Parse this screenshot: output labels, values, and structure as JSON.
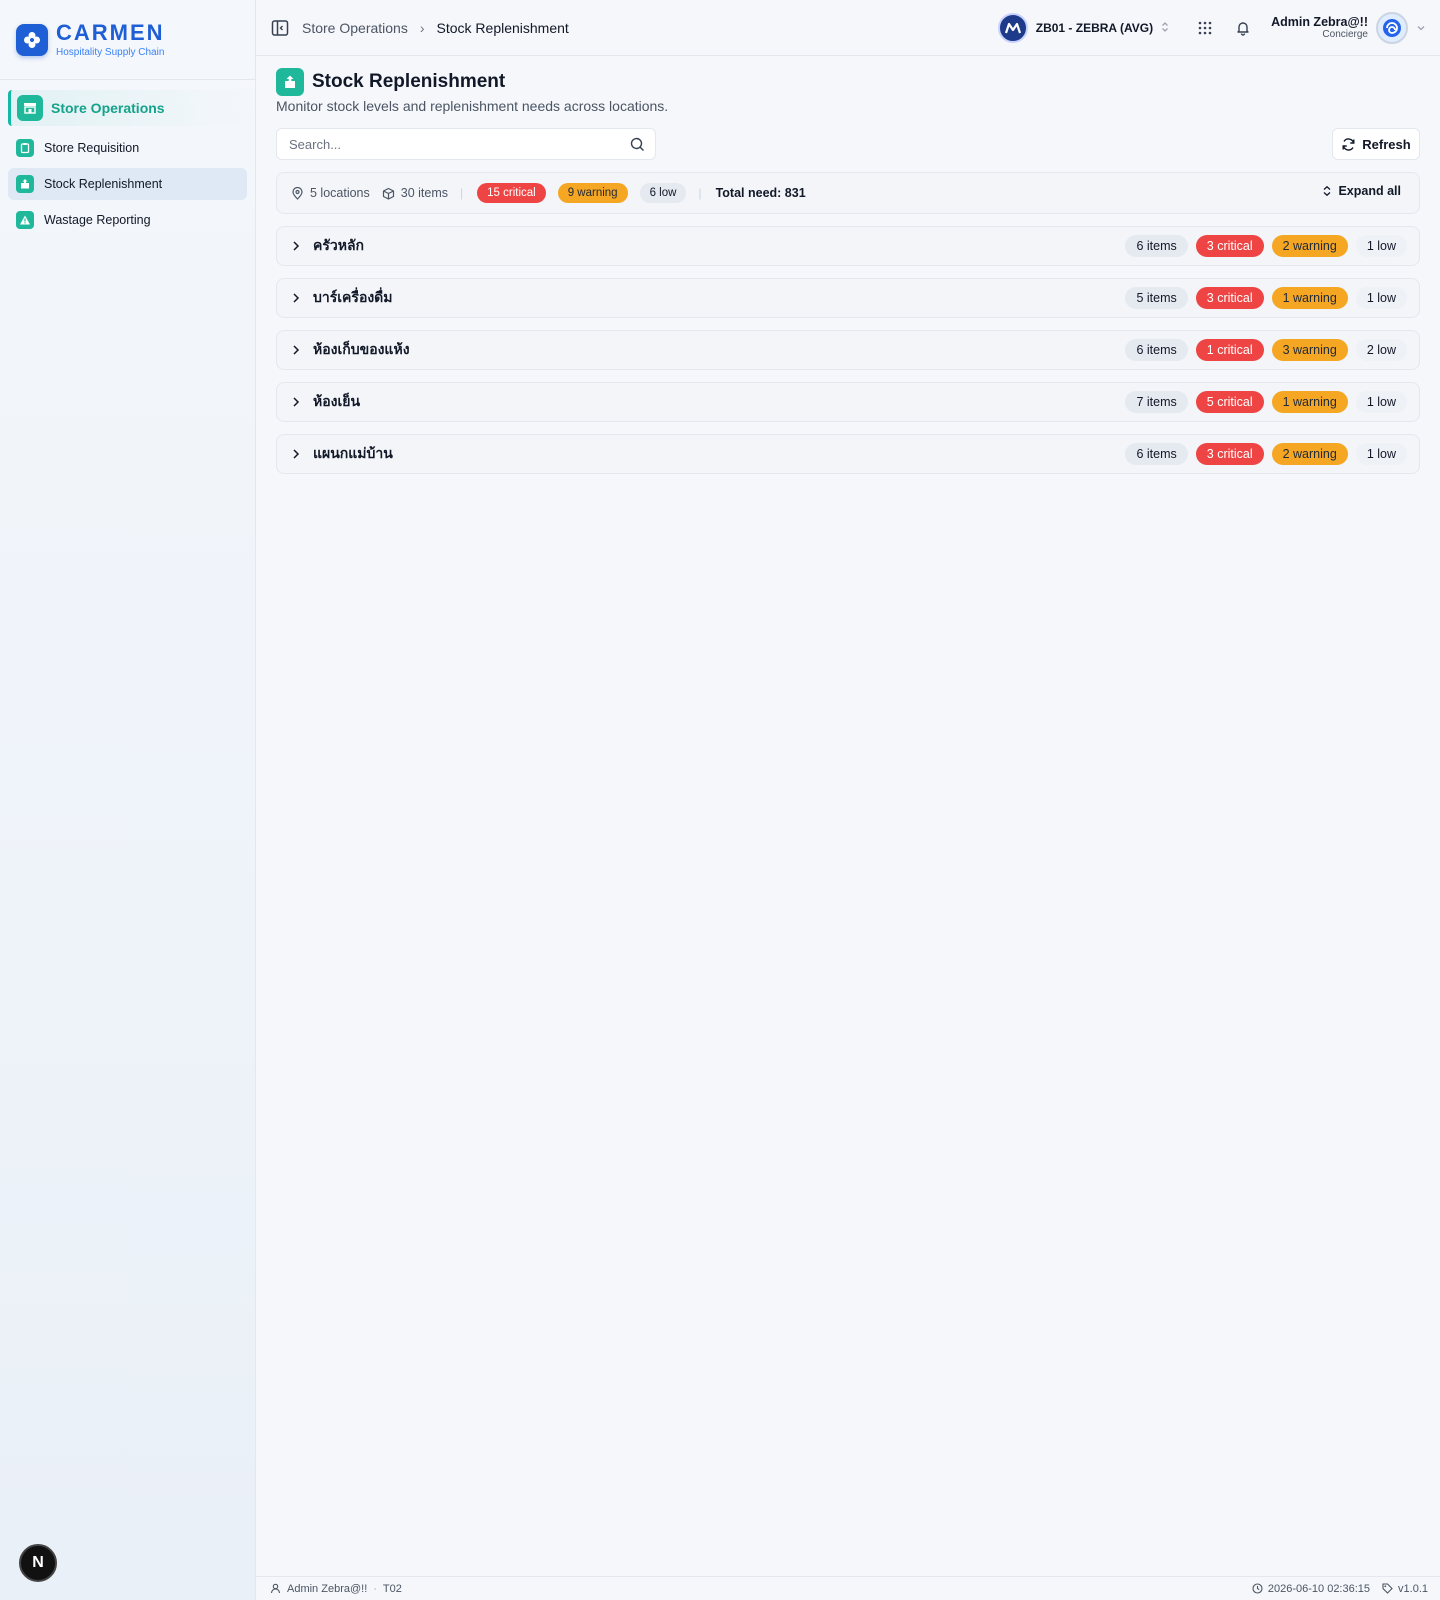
{
  "brand": {
    "name": "CARMEN",
    "tagline": "Hospitality Supply Chain"
  },
  "sidebar": {
    "section_label": "Store Operations",
    "items": [
      {
        "label": "Store Requisition",
        "icon": "clipboard-icon",
        "active": false
      },
      {
        "label": "Stock Replenishment",
        "icon": "package-up-icon",
        "active": true
      },
      {
        "label": "Wastage Reporting",
        "icon": "warning-triangle-icon",
        "active": false
      }
    ],
    "dev_badge": "N"
  },
  "header": {
    "breadcrumb": [
      "Store Operations",
      "Stock Replenishment"
    ],
    "business_unit": "ZB01 - ZEBRA (AVG)",
    "user_name": "Admin Zebra@!!",
    "user_role": "Concierge"
  },
  "page": {
    "title": "Stock Replenishment",
    "subtitle": "Monitor stock levels and replenishment needs across locations.",
    "search_placeholder": "Search...",
    "refresh_label": "Refresh"
  },
  "summary": {
    "locations": "5 locations",
    "items": "30 items",
    "critical": "15 critical",
    "warning": "9 warning",
    "low": "6 low",
    "total_need": "Total need: 831",
    "expand_label": "Expand all"
  },
  "locations": [
    {
      "name": "ครัวหลัก",
      "items": "6 items",
      "critical": "3 critical",
      "warning": "2 warning",
      "low": "1 low"
    },
    {
      "name": "บาร์เครื่องดื่ม",
      "items": "5 items",
      "critical": "3 critical",
      "warning": "1 warning",
      "low": "1 low"
    },
    {
      "name": "ห้องเก็บของแห้ง",
      "items": "6 items",
      "critical": "1 critical",
      "warning": "3 warning",
      "low": "2 low"
    },
    {
      "name": "ห้องเย็น",
      "items": "7 items",
      "critical": "5 critical",
      "warning": "1 warning",
      "low": "1 low"
    },
    {
      "name": "แผนกแม่บ้าน",
      "items": "6 items",
      "critical": "3 critical",
      "warning": "2 warning",
      "low": "1 low"
    }
  ],
  "footer": {
    "user": "Admin Zebra@!!",
    "code": "T02",
    "timestamp": "2026-06-10 02:36:15",
    "version": "v1.0.1"
  },
  "colors": {
    "brand": "#1f5fd6",
    "accent": "#1fb89a",
    "critical": "#ef4444",
    "warning": "#f5a623"
  }
}
